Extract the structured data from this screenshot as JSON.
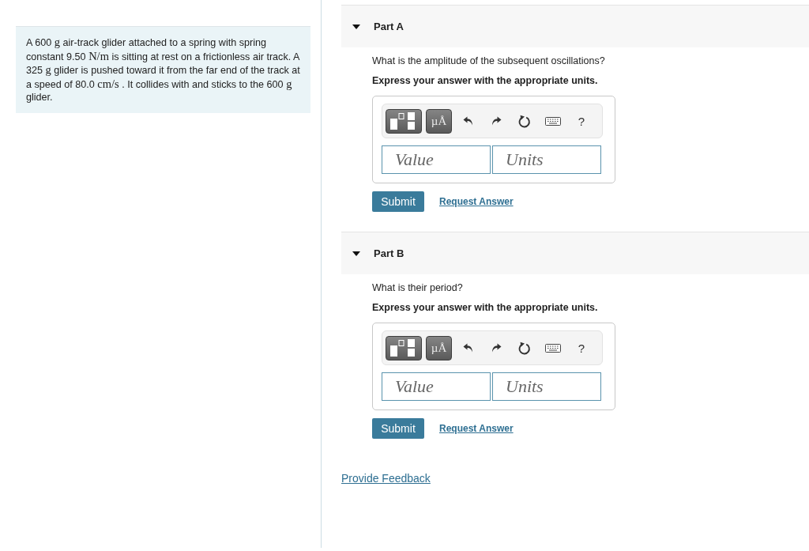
{
  "problem": {
    "segments": [
      {
        "kind": "text",
        "text": "A 600 "
      },
      {
        "kind": "math",
        "text": "g"
      },
      {
        "kind": "text",
        "text": " air-track glider attached to a spring with spring constant 9.50 "
      },
      {
        "kind": "math",
        "text": "N/m"
      },
      {
        "kind": "text",
        "text": " is sitting at rest on a frictionless air track. A 325 "
      },
      {
        "kind": "math",
        "text": "g"
      },
      {
        "kind": "text",
        "text": " glider is pushed toward it from the far end of the track at a speed of 80.0 "
      },
      {
        "kind": "math",
        "text": "cm/s"
      },
      {
        "kind": "text",
        "text": " . It collides with and sticks to the 600 "
      },
      {
        "kind": "math",
        "text": "g"
      },
      {
        "kind": "text",
        "text": " glider."
      }
    ]
  },
  "parts": [
    {
      "title": "Part A",
      "expanded": true,
      "question": "What is the amplitude of the subsequent oscillations?",
      "instruction": "Express your answer with the appropriate units.",
      "toolbar": {
        "units_button": "µÅ",
        "help_button": "?"
      },
      "value_field": {
        "placeholder": "Value"
      },
      "units_field": {
        "placeholder": "Units"
      },
      "submit_button": "Submit",
      "request_answer_link": "Request Answer"
    },
    {
      "title": "Part B",
      "expanded": true,
      "question": "What is their period?",
      "instruction": "Express your answer with the appropriate units.",
      "toolbar": {
        "units_button": "µÅ",
        "help_button": "?"
      },
      "value_field": {
        "placeholder": "Value"
      },
      "units_field": {
        "placeholder": "Units"
      },
      "submit_button": "Submit",
      "request_answer_link": "Request Answer"
    }
  ],
  "feedback_link": "Provide Feedback"
}
